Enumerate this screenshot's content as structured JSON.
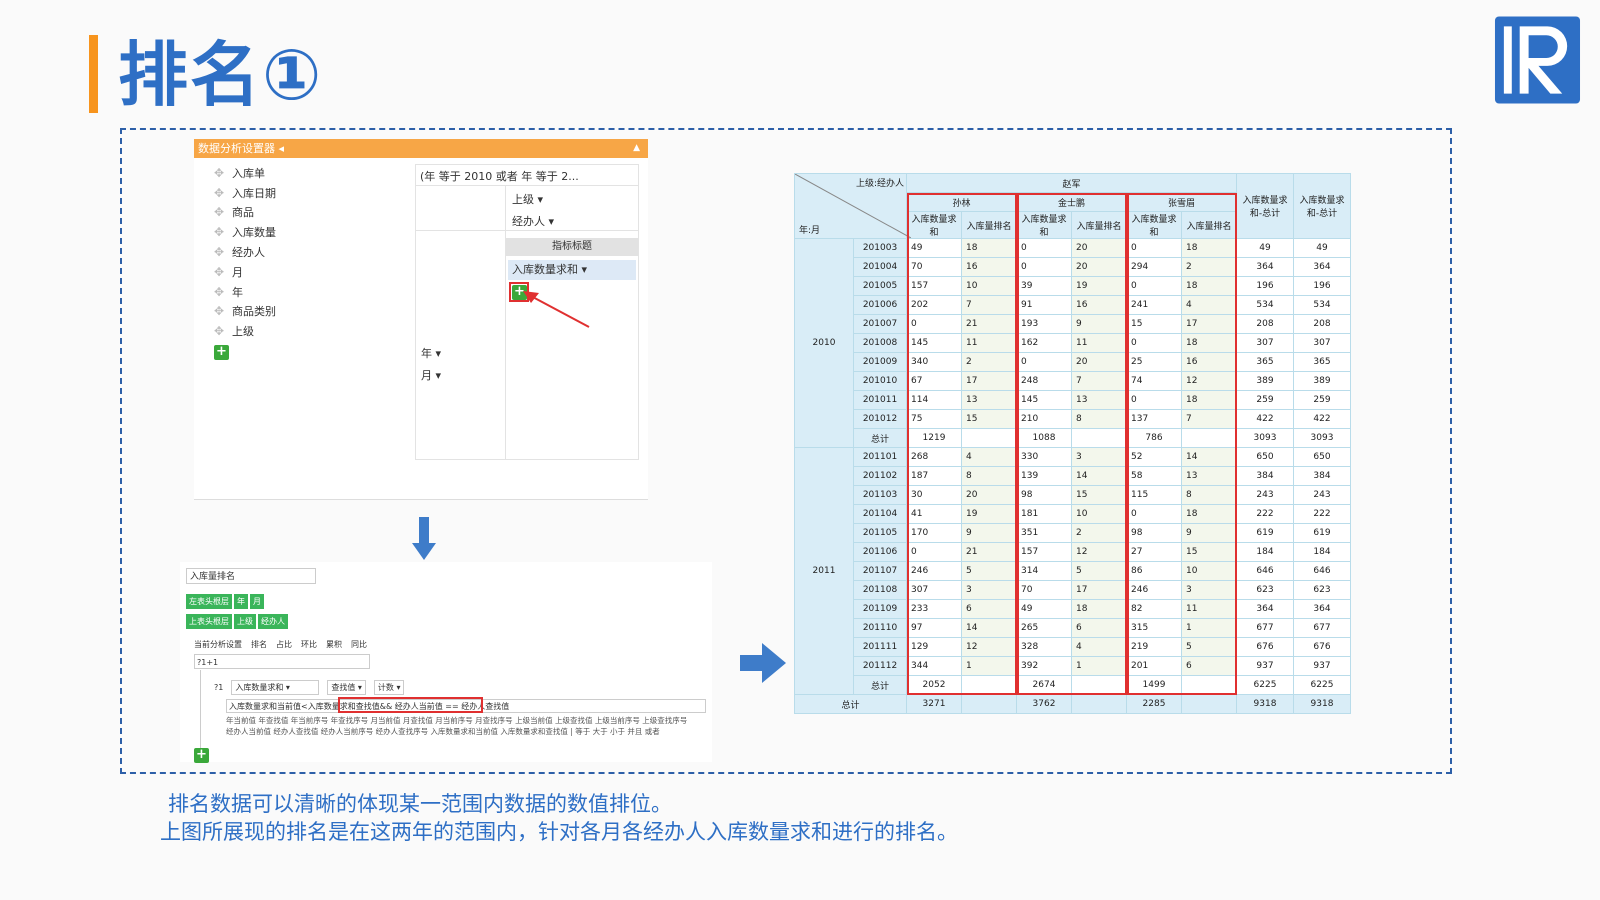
{
  "slide": {
    "title": "排名①",
    "caption_line1": "排名数据可以清晰的体现某一范围内数据的数值排位。",
    "caption_line2": "上图所展现的排名是在这两年的范围内，针对各月各经办人入库数量求和进行的排名。"
  },
  "designer": {
    "header": "数据分析设置器",
    "fields": [
      "入库单",
      "入库日期",
      "商品",
      "入库数量",
      "经办人",
      "月",
      "年",
      "商品类别",
      "上级"
    ],
    "filter": "(年 等于 2010 或者 年 等于 2...",
    "col_dims": [
      "上级 ▾",
      "经办人 ▾"
    ],
    "metric_header": "指标标题",
    "metric": "入库数量求和 ▾",
    "row_dims": [
      "年 ▾",
      "月 ▾"
    ],
    "add_icon": "+"
  },
  "rank_dialog": {
    "name": "入库量排名",
    "left_label": "左表头根层",
    "left_tags": [
      "年",
      "月"
    ],
    "top_label": "上表头根层",
    "top_tags": [
      "上级",
      "经办人"
    ],
    "tabs": [
      "当前分析设置",
      "排名",
      "占比",
      "环比",
      "累积",
      "同比"
    ],
    "formula": "?1+1",
    "row_prefix": "?1",
    "select1": "入库数量求和 ▾",
    "select2": "查找值 ▾",
    "select3": "计数 ▾",
    "expr_left": "入库数量求和当前值<入库数量求和查找值",
    "expr_right": "&& 经办人当前值 == 经办人查找值",
    "help": "年当前值 年查找值 年当前序号 年查找序号 月当前值 月查找值 月当前序号 月查找序号 上级当前值 上级查找值 上级当前序号 上级查找序号 经办人当前值 经办人查找值 经办人当前序号 经办人查找序号 入库数量求和当前值 入库数量求和查找值 | 等于 大于 小于 并且 或者"
  },
  "table": {
    "corner_top": "上级:经办人",
    "corner_bottom": "年:月",
    "supervisor": "赵军",
    "handlers": [
      "孙林",
      "金士鹏",
      "张雪眉"
    ],
    "sub_sum": "入库数量求和",
    "sub_rank": "入库量排名",
    "col_total1": "入库数量求和-总计",
    "col_total2": "入库数量求和-总计",
    "total_label": "总计",
    "grand_label": "总计",
    "years": [
      {
        "year": "2010",
        "rows": [
          [
            "201003",
            "49",
            "18",
            "0",
            "20",
            "0",
            "18",
            "49",
            "49"
          ],
          [
            "201004",
            "70",
            "16",
            "0",
            "20",
            "294",
            "2",
            "364",
            "364"
          ],
          [
            "201005",
            "157",
            "10",
            "39",
            "19",
            "0",
            "18",
            "196",
            "196"
          ],
          [
            "201006",
            "202",
            "7",
            "91",
            "16",
            "241",
            "4",
            "534",
            "534"
          ],
          [
            "201007",
            "0",
            "21",
            "193",
            "9",
            "15",
            "17",
            "208",
            "208"
          ],
          [
            "201008",
            "145",
            "11",
            "162",
            "11",
            "0",
            "18",
            "307",
            "307"
          ],
          [
            "201009",
            "340",
            "2",
            "0",
            "20",
            "25",
            "16",
            "365",
            "365"
          ],
          [
            "201010",
            "67",
            "17",
            "248",
            "7",
            "74",
            "12",
            "389",
            "389"
          ],
          [
            "201011",
            "114",
            "13",
            "145",
            "13",
            "0",
            "18",
            "259",
            "259"
          ],
          [
            "201012",
            "75",
            "15",
            "210",
            "8",
            "137",
            "7",
            "422",
            "422"
          ]
        ],
        "total": [
          "1219",
          "",
          "1088",
          "",
          "786",
          "",
          "3093",
          "3093"
        ]
      },
      {
        "year": "2011",
        "rows": [
          [
            "201101",
            "268",
            "4",
            "330",
            "3",
            "52",
            "14",
            "650",
            "650"
          ],
          [
            "201102",
            "187",
            "8",
            "139",
            "14",
            "58",
            "13",
            "384",
            "384"
          ],
          [
            "201103",
            "30",
            "20",
            "98",
            "15",
            "115",
            "8",
            "243",
            "243"
          ],
          [
            "201104",
            "41",
            "19",
            "181",
            "10",
            "0",
            "18",
            "222",
            "222"
          ],
          [
            "201105",
            "170",
            "9",
            "351",
            "2",
            "98",
            "9",
            "619",
            "619"
          ],
          [
            "201106",
            "0",
            "21",
            "157",
            "12",
            "27",
            "15",
            "184",
            "184"
          ],
          [
            "201107",
            "246",
            "5",
            "314",
            "5",
            "86",
            "10",
            "646",
            "646"
          ],
          [
            "201108",
            "307",
            "3",
            "70",
            "17",
            "246",
            "3",
            "623",
            "623"
          ],
          [
            "201109",
            "233",
            "6",
            "49",
            "18",
            "82",
            "11",
            "364",
            "364"
          ],
          [
            "201110",
            "97",
            "14",
            "265",
            "6",
            "315",
            "1",
            "677",
            "677"
          ],
          [
            "201111",
            "129",
            "12",
            "328",
            "4",
            "219",
            "5",
            "676",
            "676"
          ],
          [
            "201112",
            "344",
            "1",
            "392",
            "1",
            "201",
            "6",
            "937",
            "937"
          ]
        ],
        "total": [
          "2052",
          "",
          "2674",
          "",
          "1499",
          "",
          "6225",
          "6225"
        ]
      }
    ],
    "grand": [
      "3271",
      "",
      "3762",
      "",
      "2285",
      "",
      "9318",
      "9318"
    ]
  },
  "colors": {
    "accent": "#2e6fc5",
    "title_bar": "#f7941d",
    "red": "#e03030",
    "header_bg": "#d9edf7"
  }
}
